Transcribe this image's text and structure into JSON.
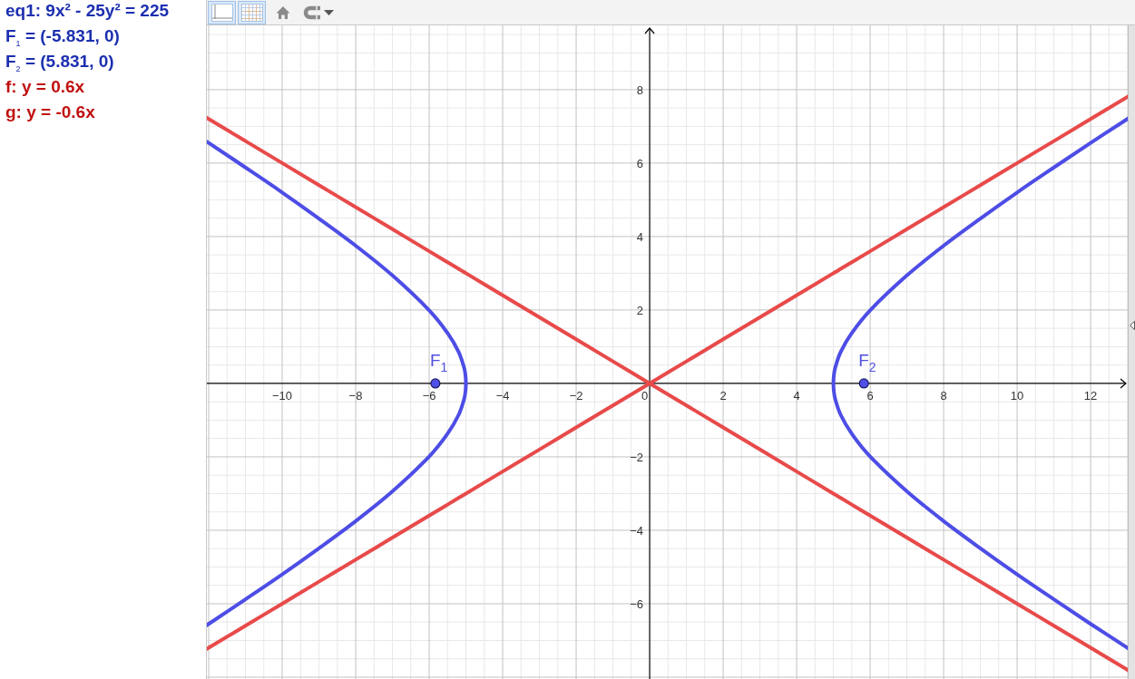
{
  "algebra_view": {
    "items": [
      {
        "text": "eq1: 9x² - 25y² = 225",
        "color": "#1c2fb0"
      },
      {
        "text": "F$_{1}$ = (-5.831, 0)",
        "color": "#1c2fb0"
      },
      {
        "text": "F$_{2}$ = (5.831, 0)",
        "color": "#1c2fb0"
      },
      {
        "text": "f: y = 0.6x",
        "color": "#c01010"
      },
      {
        "text": "g: y = -0.6x",
        "color": "#c01010"
      }
    ]
  },
  "graphics_view": {
    "style_bar": {
      "axes_toggle": {
        "selected": true
      },
      "grid_toggle": {
        "selected": true
      }
    },
    "chart_data": {
      "type": "line",
      "grid": true,
      "xlim": [
        -12.05,
        13.01
      ],
      "ylim": [
        -8.05,
        9.75
      ],
      "xticks": [
        {
          "value": -10,
          "label": "−10"
        },
        {
          "value": -8,
          "label": "−8"
        },
        {
          "value": -6,
          "label": "−6"
        },
        {
          "value": -4,
          "label": "−4"
        },
        {
          "value": -2,
          "label": "−2"
        },
        0,
        2,
        4,
        6,
        8,
        10,
        12
      ],
      "yticks": [
        {
          "value": -6,
          "label": "−6"
        },
        {
          "value": -4,
          "label": "−4"
        },
        {
          "value": -2,
          "label": "−2"
        },
        2,
        4,
        6,
        8
      ],
      "x": [
        -12.05,
        -12,
        -11,
        -10,
        -9,
        -8,
        -7,
        -6,
        -5.5,
        -5.2,
        -5.05,
        -5.01,
        -5,
        -4,
        -3,
        -2,
        -1,
        0,
        1,
        2,
        3,
        4,
        5,
        5.01,
        5.05,
        5.2,
        5.5,
        6,
        7,
        8,
        9,
        10,
        11,
        12,
        13,
        13.01
      ],
      "series": [
        {
          "color": "#4d4de6",
          "values": [
            6.58,
            6.55,
            5.88,
            5.2,
            4.49,
            3.75,
            2.94,
            1.99,
            1.37,
            0.86,
            0.43,
            0.19,
            0,
            null,
            null,
            null,
            null,
            null,
            null,
            null,
            null,
            null,
            0,
            0.19,
            0.43,
            0.86,
            1.37,
            1.99,
            2.94,
            3.75,
            4.49,
            5.2,
            5.88,
            6.55,
            7.2,
            7.21
          ]
        },
        {
          "color": "#4d4de6",
          "values": [
            -6.58,
            -6.55,
            -5.88,
            -5.2,
            -4.49,
            -3.75,
            -2.94,
            -1.99,
            -1.37,
            -0.86,
            -0.43,
            -0.19,
            0,
            null,
            null,
            null,
            null,
            null,
            null,
            null,
            null,
            null,
            0,
            -0.19,
            -0.43,
            -0.86,
            -1.37,
            -1.99,
            -2.94,
            -3.75,
            -4.49,
            -5.2,
            -5.88,
            -6.55,
            -7.2,
            -7.21
          ]
        },
        {
          "color": "#e84a4a",
          "values": [
            -7.23,
            -7.2,
            -6.6,
            -6,
            -5.4,
            -4.8,
            -4.2,
            -3.6,
            -3.3,
            -3.12,
            -3.03,
            -3.01,
            -3,
            -2.4,
            -1.8,
            -1.2,
            -0.6,
            0,
            0.6,
            1.2,
            1.8,
            2.4,
            3,
            3.01,
            3.03,
            3.12,
            3.3,
            3.6,
            4.2,
            4.8,
            5.4,
            6,
            6.6,
            7.2,
            7.8,
            7.81
          ]
        },
        {
          "color": "#e84a4a",
          "values": [
            7.23,
            7.2,
            6.6,
            6,
            5.4,
            4.8,
            4.2,
            3.6,
            3.3,
            3.12,
            3.03,
            3.01,
            3,
            2.4,
            1.8,
            1.2,
            0.6,
            0,
            -0.6,
            -1.2,
            -1.8,
            -2.4,
            -3,
            -3.01,
            -3.03,
            -3.12,
            -3.3,
            -3.6,
            -4.2,
            -4.8,
            -5.4,
            -6,
            -6.6,
            -7.2,
            -7.8,
            -7.81
          ]
        }
      ],
      "annotations": [
        {
          "x": -5.831,
          "y": 0,
          "text": "F$_{1}$"
        },
        {
          "x": 5.831,
          "y": 0,
          "text": "F$_{2}$"
        }
      ]
    }
  }
}
